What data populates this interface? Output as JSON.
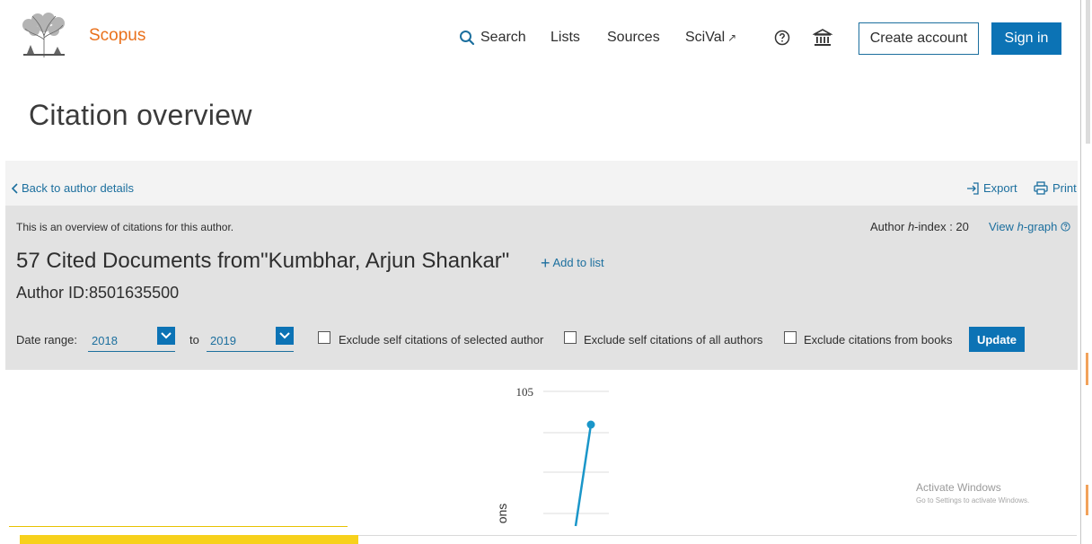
{
  "brand": {
    "name": "Scopus"
  },
  "nav": {
    "search": "Search",
    "lists": "Lists",
    "sources": "Sources",
    "scival": "SciVal",
    "scival_arrow": "↗",
    "create_account": "Create account",
    "sign_in": "Sign in"
  },
  "page": {
    "title": "Citation overview"
  },
  "toolbar": {
    "back": "Back to author details",
    "export": "Export",
    "print": "Print"
  },
  "overview": {
    "intro": "This is an overview of citations for this author.",
    "hindex_label": "Author",
    "hindex_h": "h",
    "hindex_suffix": "-index : 20",
    "view_label": "View",
    "view_h": "h",
    "view_suffix": "-graph",
    "docs_title": "57 Cited Documents from\"Kumbhar, Arjun Shankar\"",
    "add_to_list": "Add to list",
    "author_id": "Author ID:8501635500"
  },
  "filters": {
    "date_range_label": "Date range:",
    "from": "2018",
    "to_label": "to",
    "to": "2019",
    "exclude_self_selected": "Exclude self citations of selected author",
    "exclude_self_all": "Exclude self citations of all authors",
    "exclude_books": "Exclude citations from books",
    "update": "Update"
  },
  "chart_data": {
    "type": "line",
    "ytick_top": "105",
    "ylabel_fragment": "ons",
    "grid": true
  },
  "watermark": {
    "title": "Activate Windows",
    "subtitle": "Go to Settings to activate Windows."
  },
  "colors": {
    "brand_orange": "#e9711c",
    "link_blue": "#1c6f9e",
    "primary_blue": "#0c73b5",
    "series_line": "#1a96c9",
    "highlight_yellow": "#f7d11c"
  },
  "icons": {
    "logo": "elsevier-tree-logo",
    "search": "search-icon",
    "help": "help-circle-icon",
    "institution": "institution-icon",
    "back": "chevron-left-icon",
    "export": "export-icon",
    "print": "print-icon",
    "plus": "plus-icon",
    "chevron": "chevron-down-icon"
  }
}
